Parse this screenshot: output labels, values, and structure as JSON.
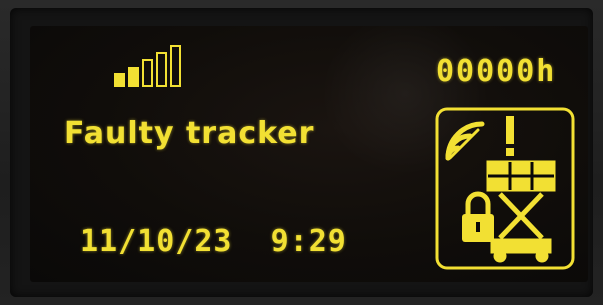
{
  "display": {
    "hour_counter": "00000h",
    "status_message": "Faulty tracker",
    "date": "11/10/23",
    "time": "9:29"
  },
  "indicators": {
    "signal_strength_icon": "signal-bars-icon",
    "status_icon": "tracker-warning-lock-icon"
  },
  "colors": {
    "display_text": "#f2e033",
    "screen_background": "#0a0908"
  }
}
